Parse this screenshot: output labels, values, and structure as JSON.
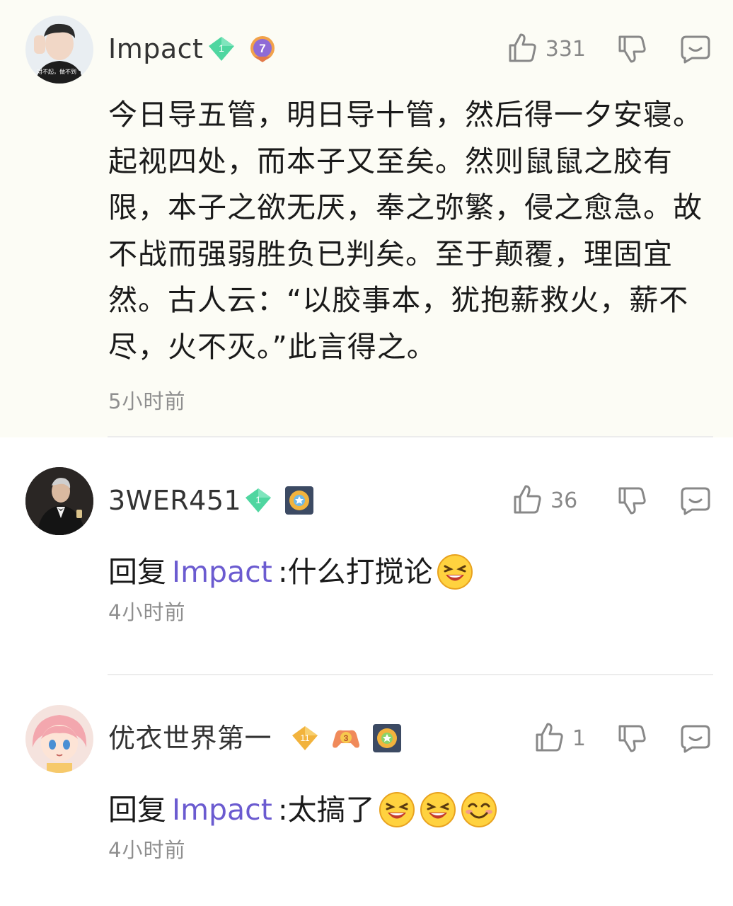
{
  "comments": [
    {
      "username": "Impact",
      "avatar_text": "对不起，做不到",
      "badges": [
        {
          "icon": "diamond-level-badge-icon",
          "label": "1",
          "color": "#4fd6a0"
        },
        {
          "icon": "shield-rank-badge-icon",
          "label": "7",
          "color": "#8e6bd6"
        }
      ],
      "likes": "331",
      "text": "今日导五管，明日导十管，然后得一夕安寝。起视四处，而本子又至矣。然则鼠鼠之胶有限，本子之欲无厌，奉之弥繁，侵之愈急。故不战而强弱胜负已判矣。至于颠覆，理固宜然。古人云：“以胶事本，犹抱薪救火，薪不尽，火不灭。”此言得之。",
      "time": "5小时前"
    },
    {
      "username": "3WER451",
      "badges": [
        {
          "icon": "diamond-level-badge-icon",
          "label": "1",
          "color": "#4fd6a0"
        },
        {
          "icon": "sun-medal-badge-icon",
          "color": "#e6a93a"
        }
      ],
      "likes": "36",
      "reply_prefix": "回复",
      "mention": "Impact",
      "reply_text": ":什么打搅论",
      "emojis": [
        "laughing-emoji-icon"
      ],
      "time": "4小时前"
    },
    {
      "username": "优衣世界第一",
      "badges": [
        {
          "icon": "diamond-level-badge-icon",
          "label": "11",
          "color": "#f2b33d"
        },
        {
          "icon": "gamepad-badge-icon",
          "label": "3",
          "color": "#f08a5a"
        },
        {
          "icon": "sun-medal-badge-icon",
          "color": "#e6a93a"
        }
      ],
      "likes": "1",
      "reply_prefix": "回复",
      "mention": "Impact",
      "reply_text": ":太搞了",
      "emojis": [
        "laughing-emoji-icon",
        "laughing-emoji-icon",
        "grinning-emoji-icon"
      ],
      "time": "4小时前"
    }
  ]
}
